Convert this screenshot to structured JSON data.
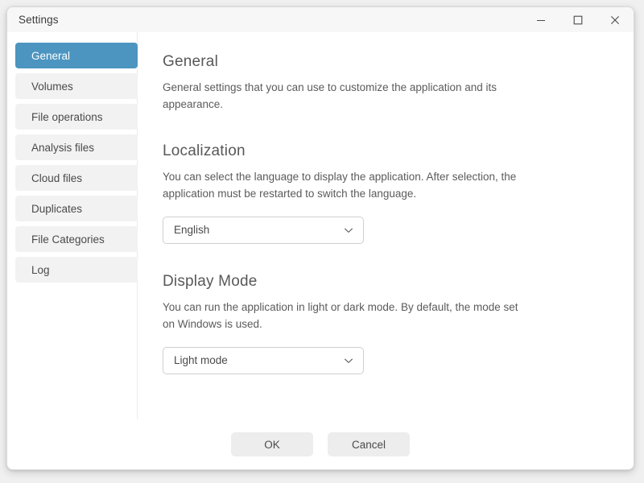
{
  "window": {
    "title": "Settings",
    "controls": {
      "minimize": "minimize-icon",
      "maximize": "maximize-icon",
      "close": "close-icon"
    }
  },
  "sidebar": {
    "items": [
      {
        "label": "General",
        "selected": true
      },
      {
        "label": "Volumes",
        "selected": false
      },
      {
        "label": "File operations",
        "selected": false
      },
      {
        "label": "Analysis files",
        "selected": false
      },
      {
        "label": "Cloud files",
        "selected": false
      },
      {
        "label": "Duplicates",
        "selected": false
      },
      {
        "label": "File Categories",
        "selected": false
      },
      {
        "label": "Log",
        "selected": false
      }
    ]
  },
  "content": {
    "general": {
      "heading": "General",
      "description": "General settings that you can use to customize the application and its appearance."
    },
    "localization": {
      "heading": "Localization",
      "description": "You can select the language to display the application. After selection, the application must be restarted to switch the language.",
      "dropdown": {
        "value": "English",
        "icon": "chevron-down-icon"
      }
    },
    "display_mode": {
      "heading": "Display Mode",
      "description": "You can run the application in light or dark mode. By default, the mode set on Windows is used.",
      "dropdown": {
        "value": "Light mode",
        "icon": "chevron-down-icon"
      }
    }
  },
  "footer": {
    "ok_label": "OK",
    "cancel_label": "Cancel"
  },
  "colors": {
    "accent": "#4c95c0",
    "nav_item_bg": "#f2f2f2",
    "titlebar_bg": "#f7f7f7",
    "button_bg": "#ededed",
    "text": "#4a4a4a",
    "divider": "#ebebeb"
  }
}
